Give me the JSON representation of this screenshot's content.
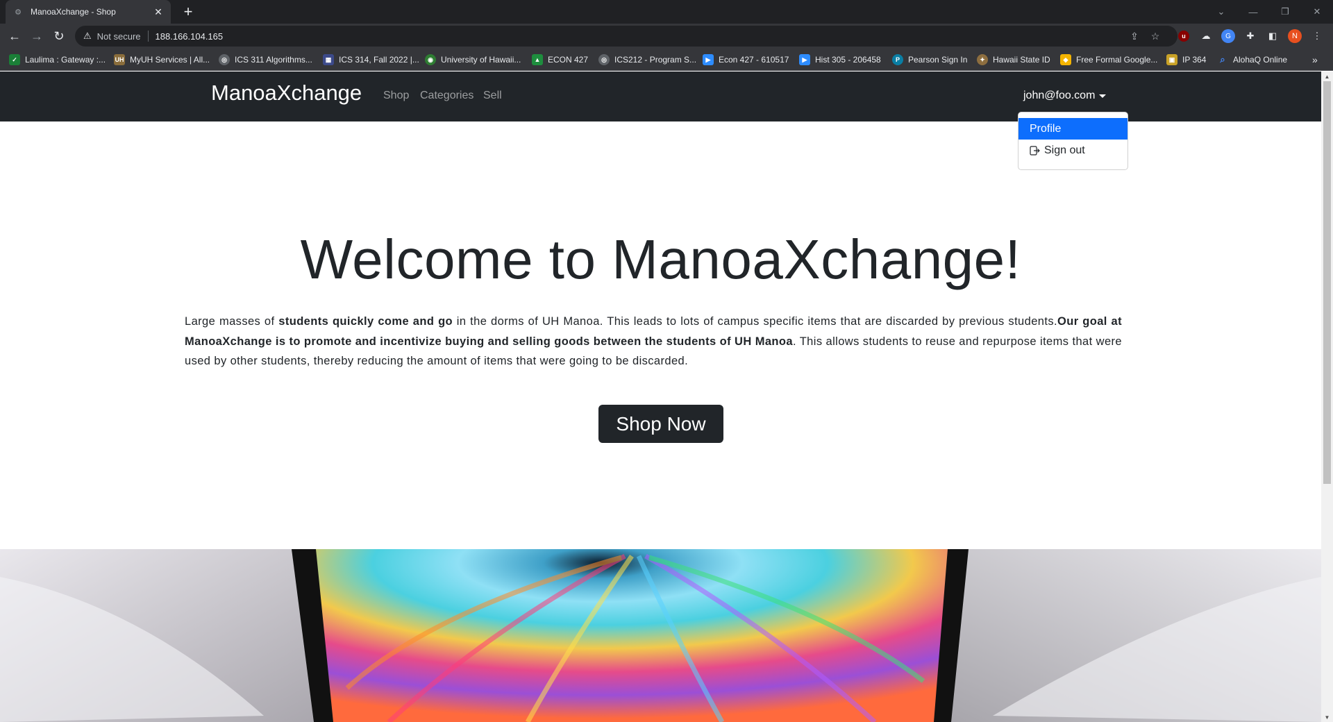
{
  "browser": {
    "tab_title": "ManoaXchange - Shop",
    "tab_close": "✕",
    "new_tab": "+",
    "not_secure": "Not secure",
    "url": "188.166.104.165",
    "profile_initial": "N",
    "bookmarks": [
      {
        "label": "Laulima : Gateway :...",
        "color": "#1a7f37"
      },
      {
        "label": "MyUH Services | All...",
        "color": "#8a6d3b"
      },
      {
        "label": "ICS 311 Algorithms...",
        "color": "#5f6368"
      },
      {
        "label": "ICS 314, Fall 2022 |...",
        "color": "#3c4a8a"
      },
      {
        "label": "University of Hawaii...",
        "color": "#2e7d32"
      },
      {
        "label": "ECON 427",
        "color": "#1e8e3e"
      },
      {
        "label": "ICS212 - Program S...",
        "color": "#5f6368"
      },
      {
        "label": "Econ 427 - 610517",
        "color": "#2d8cff"
      },
      {
        "label": "Hist 305 - 206458",
        "color": "#2d8cff"
      },
      {
        "label": "Pearson Sign In",
        "color": "#0a7ea4"
      },
      {
        "label": "Hawaii State ID",
        "color": "#8d6e3f"
      },
      {
        "label": "Free Formal Google...",
        "color": "#f4b400"
      },
      {
        "label": "IP 364",
        "color": "#c9a227"
      },
      {
        "label": "AlohaQ Online",
        "color": "#4285f4"
      }
    ]
  },
  "navbar": {
    "brand": "ManoaXchange",
    "links": [
      "Shop",
      "Categories",
      "Sell"
    ],
    "user": "john@foo.com"
  },
  "dropdown": {
    "profile": "Profile",
    "sign_out": "Sign out"
  },
  "hero": {
    "title": "Welcome to ManoaXchange!",
    "p1": "Large masses of ",
    "b1": "students quickly come and go",
    "p2": " in the dorms of UH Manoa. This leads to lots of campus specific items that are discarded by previous students.",
    "b2": "Our goal at ManoaXchange is to promote and incentivize buying and selling goods between the students of UH Manoa",
    "p3": ". This allows students to reuse and repurpose items that were used by other students, thereby reducing the amount of items that were going to be discarded.",
    "button": "Shop Now"
  },
  "colors": {
    "navbar_bg": "#212529",
    "dropdown_active": "#0d6efd",
    "button_bg": "#212529"
  }
}
